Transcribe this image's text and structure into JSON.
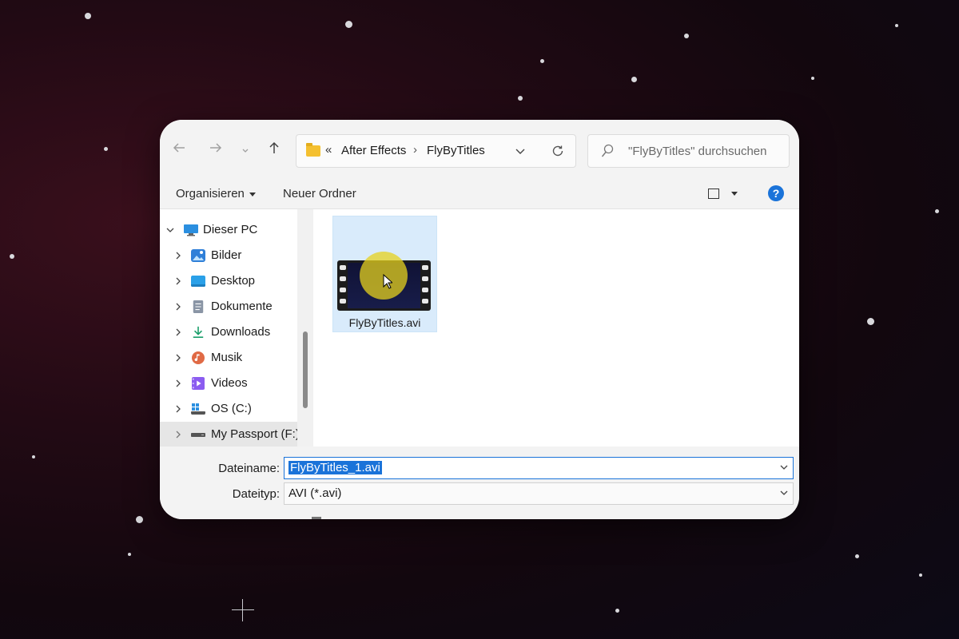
{
  "toolbar": {
    "back_icon": "arrow-left-icon",
    "forward_icon": "arrow-right-icon",
    "recent_icon": "chevron-down-icon",
    "up_icon": "arrow-up-icon"
  },
  "address": {
    "overflow": "«",
    "segments": [
      "After Effects",
      "FlyByTitles"
    ],
    "separator": "›",
    "refresh_icon": "refresh-icon"
  },
  "search": {
    "placeholder": "\"FlyByTitles\" durchsuchen",
    "icon": "search-icon"
  },
  "commands": {
    "organize": "Organisieren",
    "new_folder": "Neuer Ordner",
    "help": "?"
  },
  "sidebar": {
    "root": {
      "label": "Dieser PC",
      "icon": "monitor-icon",
      "expanded": true
    },
    "items": [
      {
        "label": "Bilder",
        "icon": "pictures-icon",
        "color": "#2f7fd8"
      },
      {
        "label": "Desktop",
        "icon": "desktop-icon",
        "color": "#2aa0e8"
      },
      {
        "label": "Dokumente",
        "icon": "documents-icon",
        "color": "#8a95a5"
      },
      {
        "label": "Downloads",
        "icon": "download-icon",
        "color": "#1a9e6a"
      },
      {
        "label": "Musik",
        "icon": "music-icon",
        "color": "#e06a45"
      },
      {
        "label": "Videos",
        "icon": "videos-icon",
        "color": "#8b5cf0"
      },
      {
        "label": "OS (C:)",
        "icon": "drive-windows-icon",
        "color": "#555555"
      },
      {
        "label": "My Passport (F:)",
        "icon": "drive-icon",
        "color": "#555555",
        "selected": true
      }
    ]
  },
  "files": [
    {
      "name": "FlyByTitles.avi",
      "icon": "video-file-icon",
      "selected": true
    }
  ],
  "save": {
    "filename_label": "Dateiname:",
    "filename_value": "FlyByTitles_1.avi",
    "filetype_label": "Dateityp:",
    "filetype_value": "AVI (*.avi)"
  },
  "colors": {
    "accent": "#1a73d9",
    "selection": "#d9ebfb",
    "highlight": "#e6d21e"
  }
}
